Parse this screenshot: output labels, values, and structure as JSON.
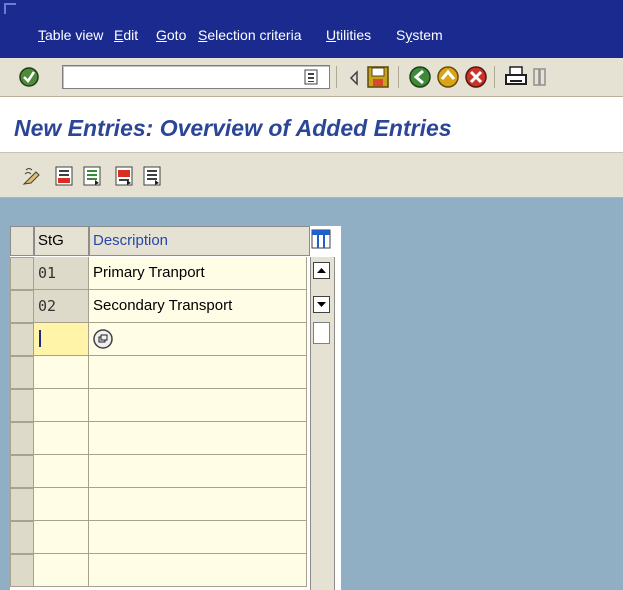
{
  "menu": {
    "items": [
      {
        "pre": "",
        "ul": "T",
        "post": "able view"
      },
      {
        "pre": "",
        "ul": "E",
        "post": "dit"
      },
      {
        "pre": "",
        "ul": "G",
        "post": "oto"
      },
      {
        "pre": "",
        "ul": "S",
        "post": "election criteria"
      },
      {
        "pre": "",
        "ul": "U",
        "post": "tilities"
      },
      {
        "pre": "S",
        "ul": "y",
        "post": "stem"
      }
    ]
  },
  "toolbar": {
    "command_value": "",
    "icons": [
      "enter-icon",
      "history-dropdown-icon",
      "collapse-arrow-icon",
      "save-icon",
      "back-icon",
      "exit-icon",
      "cancel-icon",
      "print-icon",
      "find-icon"
    ]
  },
  "page": {
    "title": "New Entries: Overview of Added Entries"
  },
  "app_toolbar": {
    "icons": [
      "display-change-icon",
      "delete-icon",
      "select-all-icon",
      "select-block-icon",
      "deselect-all-icon"
    ]
  },
  "table": {
    "columns": [
      "StG",
      "Description"
    ],
    "rows": [
      {
        "stg": "01",
        "description": "Primary Tranport"
      },
      {
        "stg": "02",
        "description": "Secondary Transport"
      },
      {
        "stg": "",
        "description": ""
      },
      {
        "stg": "",
        "description": ""
      },
      {
        "stg": "",
        "description": ""
      },
      {
        "stg": "",
        "description": ""
      },
      {
        "stg": "",
        "description": ""
      },
      {
        "stg": "",
        "description": ""
      },
      {
        "stg": "",
        "description": ""
      },
      {
        "stg": "",
        "description": ""
      }
    ]
  },
  "colors": {
    "menubar": "#1a2a8e",
    "toolbar": "#e6e2d3",
    "title": "#2b4597",
    "background": "#90aec4",
    "input_cell": "#fffde6"
  }
}
